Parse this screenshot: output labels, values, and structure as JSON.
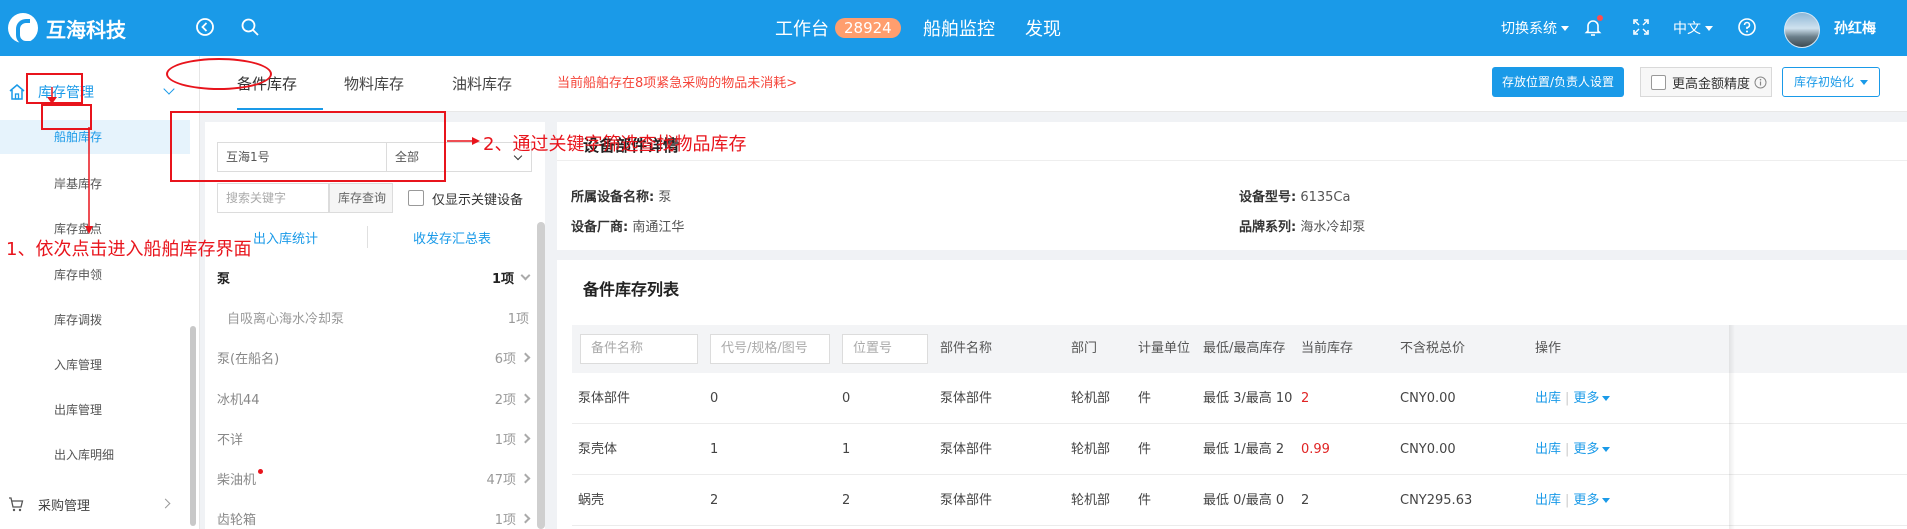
{
  "brand": {
    "name": "互海科技"
  },
  "nav": {
    "workbench": "工作台",
    "workbench_count": "28924",
    "ship_monitor": "船舶监控",
    "discover": "发现",
    "switch_system": "切换系统",
    "language": "中文",
    "username": "孙红梅"
  },
  "sidebar": {
    "section": "库存管理",
    "items": [
      "船舶库存",
      "岸基库存",
      "库存盘点",
      "库存申领",
      "库存调拨",
      "入库管理",
      "出库管理",
      "出入库明细"
    ],
    "next_section": "采购管理"
  },
  "tabs": {
    "items": [
      "备件库存",
      "物料库存",
      "油料库存"
    ],
    "active": "备件库存",
    "alert": "当前船舶存在8项紧急采购的物品未消耗>",
    "btn_location": "存放位置/负责人设置",
    "higher_precision": "更高金额精度",
    "btn_init": "库存初始化"
  },
  "filter": {
    "ship_value": "互海1号",
    "dept_value": "全部",
    "search_placeholder": "搜索关键字",
    "search_button": "库存查询",
    "only_key_equipment": "仅显示关键设备",
    "link_stats": "出入库统计",
    "link_summary": "收发存汇总表"
  },
  "categories": [
    {
      "name": "泵",
      "count": "1项",
      "expanded": true
    },
    {
      "name": "自吸离心海水冷却泵",
      "count": "1项",
      "child": true
    },
    {
      "name": "泵(在船名)",
      "count": "6项"
    },
    {
      "name": "冰机44",
      "count": "2项"
    },
    {
      "name": "不详",
      "count": "1项"
    },
    {
      "name": "柴油机",
      "count": "47项",
      "dot": true
    },
    {
      "name": "齿轮箱",
      "count": "1项"
    }
  ],
  "detail": {
    "title": "设备部件详情",
    "equip_name_label": "所属设备名称:",
    "equip_name": "泵",
    "model_label": "设备型号:",
    "model": "6135Ca",
    "maker_label": "设备厂商:",
    "maker": "南通江华",
    "brand_label": "品牌系列:",
    "brand": "海水冷却泵"
  },
  "table": {
    "title": "备件库存列表",
    "placeholders": {
      "name": "备件名称",
      "code": "代号/规格/图号",
      "location": "位置号"
    },
    "headers": [
      "部件名称",
      "部门",
      "计量单位",
      "最低/最高库存",
      "当前库存",
      "不含税总价",
      "操作"
    ],
    "rows": [
      {
        "name": "泵体部件",
        "code": "0",
        "location": "0",
        "part": "泵体部件",
        "dept": "轮机部",
        "unit": "件",
        "minmax": "最低 3/最高 10",
        "current": "2",
        "current_red": true,
        "total": "CNY0.00"
      },
      {
        "name": "泵壳体",
        "code": "1",
        "location": "1",
        "part": "泵体部件",
        "dept": "轮机部",
        "unit": "件",
        "minmax": "最低 1/最高 2",
        "current": "0.99",
        "current_red": true,
        "total": "CNY0.00"
      },
      {
        "name": "蜗壳",
        "code": "2",
        "location": "2",
        "part": "泵体部件",
        "dept": "轮机部",
        "unit": "件",
        "minmax": "最低 0/最高 0",
        "current": "2",
        "current_red": false,
        "total": "CNY295.63"
      }
    ],
    "op_out": "出库",
    "op_more": "更多"
  },
  "annotations": {
    "step1": "1、依次点击进入船舶库存界面",
    "step2": "2、通过关键字筛选查找物品库存"
  }
}
